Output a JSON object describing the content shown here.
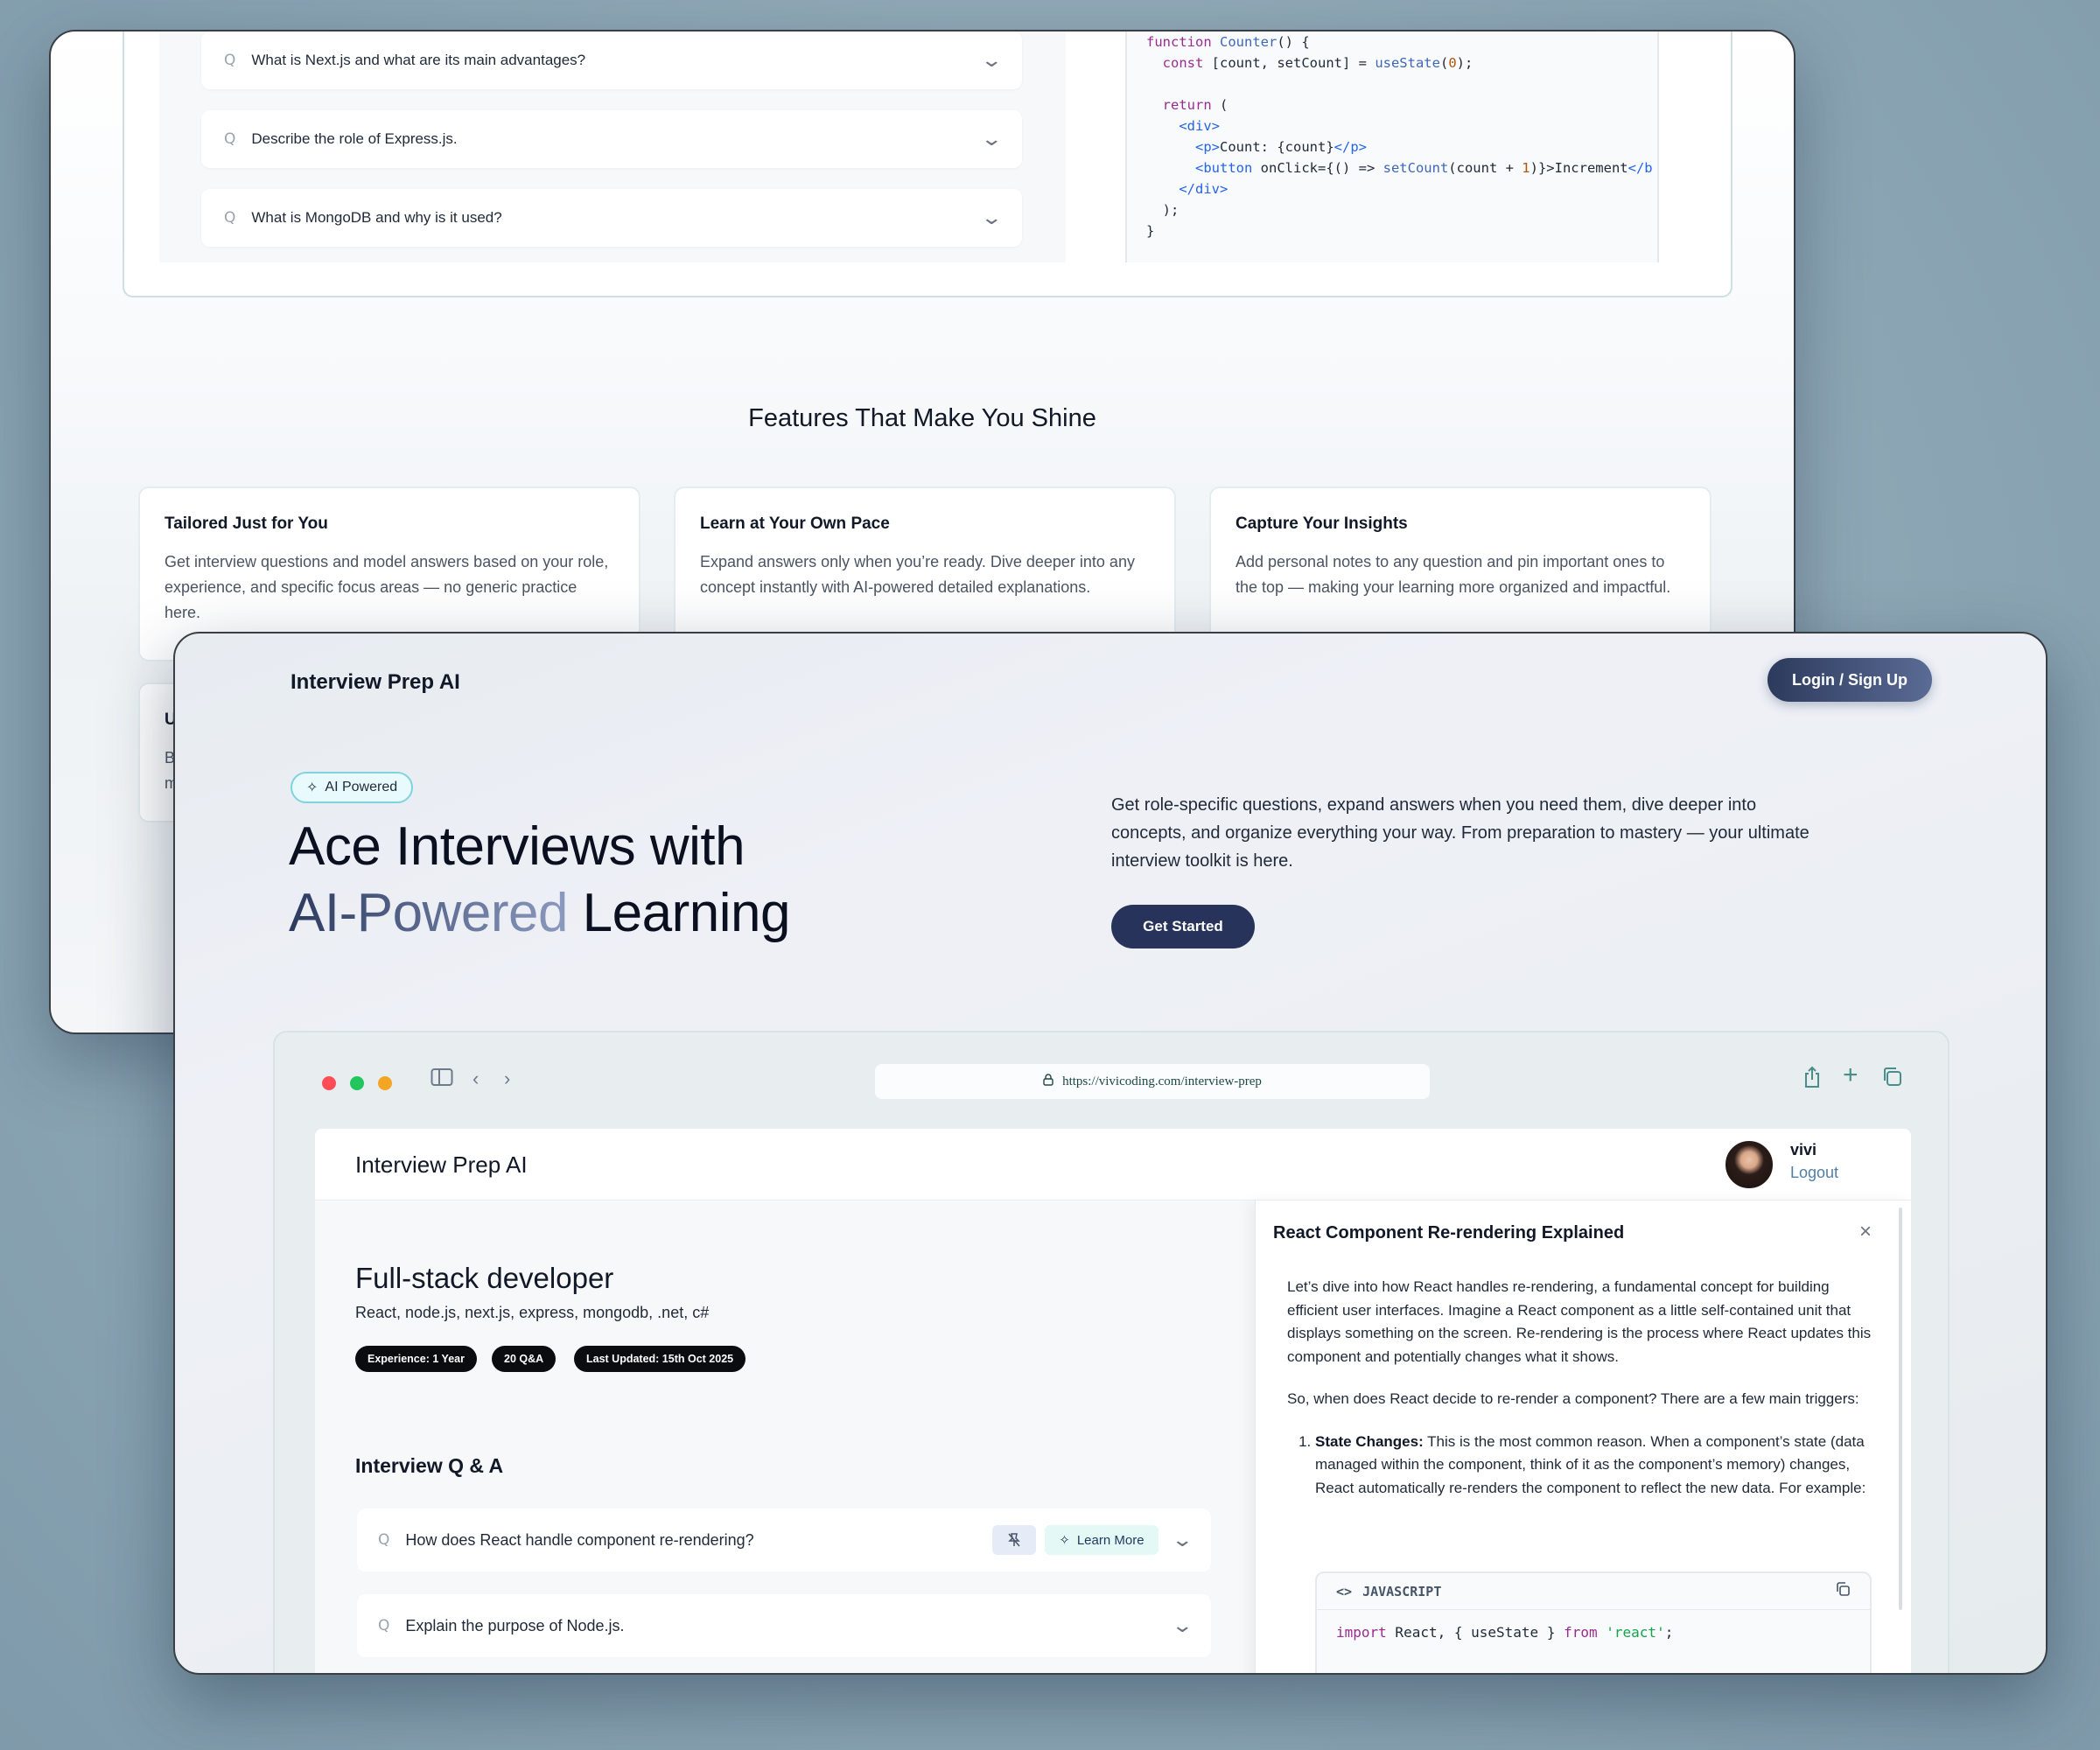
{
  "back_window": {
    "faq": [
      {
        "q_icon": "Q",
        "text": "What is Next.js and what are its main advantages?"
      },
      {
        "q_icon": "Q",
        "text": "Describe the role of Express.js."
      },
      {
        "q_icon": "Q",
        "text": "What is MongoDB and why is it used?"
      }
    ],
    "code_lines": [
      "function Counter() {",
      "  const [count, setCount] = useState(0);",
      "",
      "  return (",
      "    <div>",
      "      <p>Count: {count}</p>",
      "      <button onClick={() => setCount(count + 1)}>Increment</b",
      "    </div>",
      "  );",
      "}"
    ],
    "features_title": "Features That Make You Shine",
    "features": [
      {
        "title": "Tailored Just for You",
        "desc": "Get interview questions and model answers based on your role, experience, and specific focus areas — no generic practice here."
      },
      {
        "title": "Learn at Your Own Pace",
        "desc": "Expand answers only when you’re ready. Dive deeper into any concept instantly with AI-powered detailed explanations."
      },
      {
        "title": "Capture Your Insights",
        "desc": "Add personal notes to any question and pin important ones to the top — making your learning more organized and impactful."
      }
    ],
    "feature_row2_partial": {
      "title": "U",
      "line1": "B",
      "line2": "m"
    }
  },
  "front_window": {
    "brand": "Interview Prep AI",
    "login_label": "Login / Sign Up",
    "badge_label": "AI Powered",
    "hero_line1": "Ace Interviews with",
    "hero_grad": "AI-Powered",
    "hero_line2_rest": "Learning",
    "hero_desc": "Get role-specific questions, expand answers when you need them, dive deeper into concepts, and organize everything your way. From preparation to mastery — your ultimate interview toolkit is here.",
    "cta_label": "Get Started",
    "colors": {
      "accent": "#27335a",
      "badge_border": "#7fd3df",
      "grad_start": "#2b3a5e",
      "grad_end": "#8c9ac0"
    }
  },
  "browser": {
    "url": "https://vivicoding.com/interview-prep",
    "traffic_lights": [
      "#ff4d57",
      "#22c55e",
      "#f5a524"
    ],
    "inner_brand": "Interview Prep AI",
    "user_name": "vivi",
    "logout_label": "Logout",
    "role_title": "Full-stack developer",
    "role_stack": "React, node.js, next.js, express, mongodb, .net, c#",
    "pills": [
      "Experience: 1 Year",
      "20 Q&A",
      "Last Updated: 15th Oct 2025"
    ],
    "qa_title": "Interview Q & A",
    "qa_items": [
      {
        "q_icon": "Q",
        "text": "How does React handle component re-rendering?",
        "learn_more": "Learn More"
      },
      {
        "q_icon": "Q",
        "text": "Explain the purpose of Node.js."
      }
    ]
  },
  "drawer": {
    "title": "React Component Re-rendering Explained",
    "para1": "Let’s dive into how React handles re-rendering, a fundamental concept for building efficient user interfaces. Imagine a React component as a little self-contained unit that displays something on the screen. Re-rendering is the process where React updates this component and potentially changes what it shows.",
    "para2": "So, when does React decide to re-render a component? There are a few main triggers:",
    "list_item_bold": "State Changes:",
    "list_item_text": " This is the most common reason. When a component’s state (data managed within the component, think of it as the component’s memory) changes, React automatically re-renders the component to reflect the new data. For example:",
    "code_lang": "JAVASCRIPT",
    "code_line": "import React, { useState } from 'react';"
  }
}
